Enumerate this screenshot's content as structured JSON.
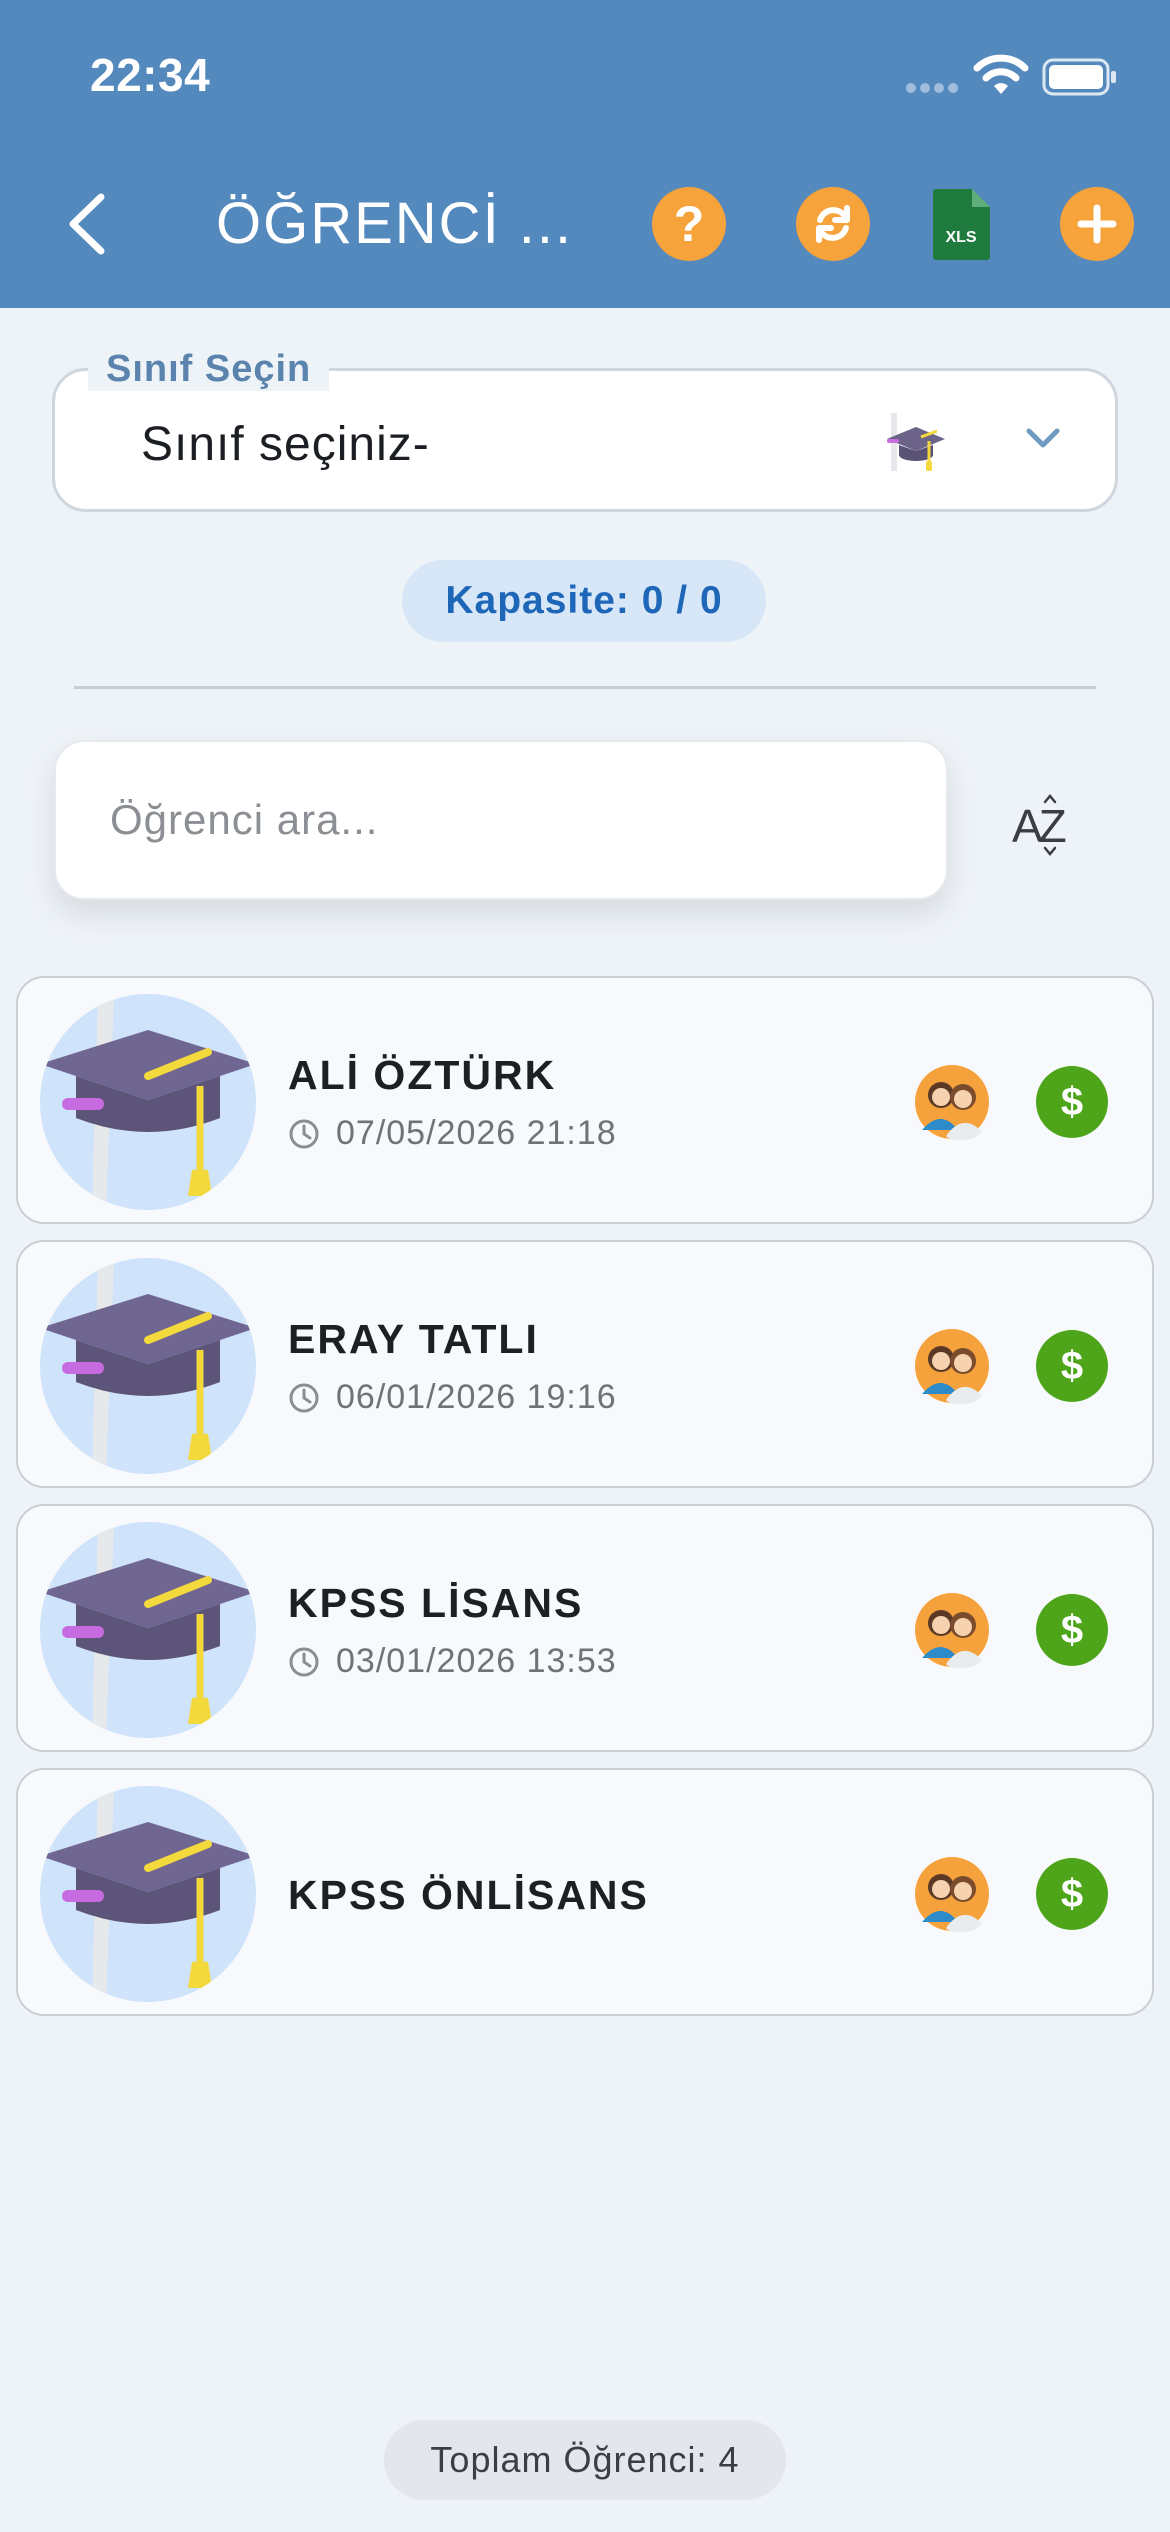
{
  "status_bar": {
    "time": "22:34"
  },
  "header": {
    "title": "ÖĞRENCİ ...",
    "help_label": "?",
    "excel_label": "XLS",
    "colors": {
      "bar": "#5389bd",
      "action": "#f7a33b",
      "excel": "#1f7a3e"
    }
  },
  "class_select": {
    "legend": "Sınıf Seçin",
    "value": "Sınıf seçiniz-"
  },
  "capacity": {
    "text": "Kapasite: 0 / 0"
  },
  "search": {
    "placeholder": "Öğrenci ara..."
  },
  "sort": {
    "label": "AZ"
  },
  "students": [
    {
      "name": "ALİ ÖZTÜRK",
      "date": "07/05/2026 21:18"
    },
    {
      "name": "ERAY TATLI",
      "date": "06/01/2026 19:16"
    },
    {
      "name": "KPSS LİSANS",
      "date": "03/01/2026 13:53"
    },
    {
      "name": "KPSS ÖNLİSANS",
      "date": ""
    }
  ],
  "row_actions": {
    "pay_label": "$"
  },
  "footer": {
    "total": "Toplam Öğrenci: 4"
  }
}
